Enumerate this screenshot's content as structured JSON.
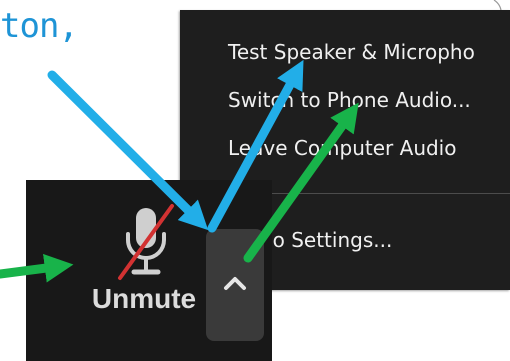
{
  "caption": {
    "text": "ton,"
  },
  "menu": {
    "items": [
      {
        "label": "Test Speaker & Micropho"
      },
      {
        "label": "Switch to Phone Audio..."
      },
      {
        "label": "Leave Computer Audio"
      },
      {
        "label": "Audio Settings..."
      }
    ]
  },
  "toolbar": {
    "unmute_label": "Unmute",
    "mic_icon": "microphone-muted-icon",
    "caret_icon": "chevron-up-icon"
  },
  "colors": {
    "blue_arrow": "#22aee8",
    "green_arrow": "#18b34a",
    "caption_text": "#1e94d6",
    "menu_bg": "#1e1e1e",
    "toolbar_bg": "#181818",
    "mute_slash": "#d23232"
  }
}
